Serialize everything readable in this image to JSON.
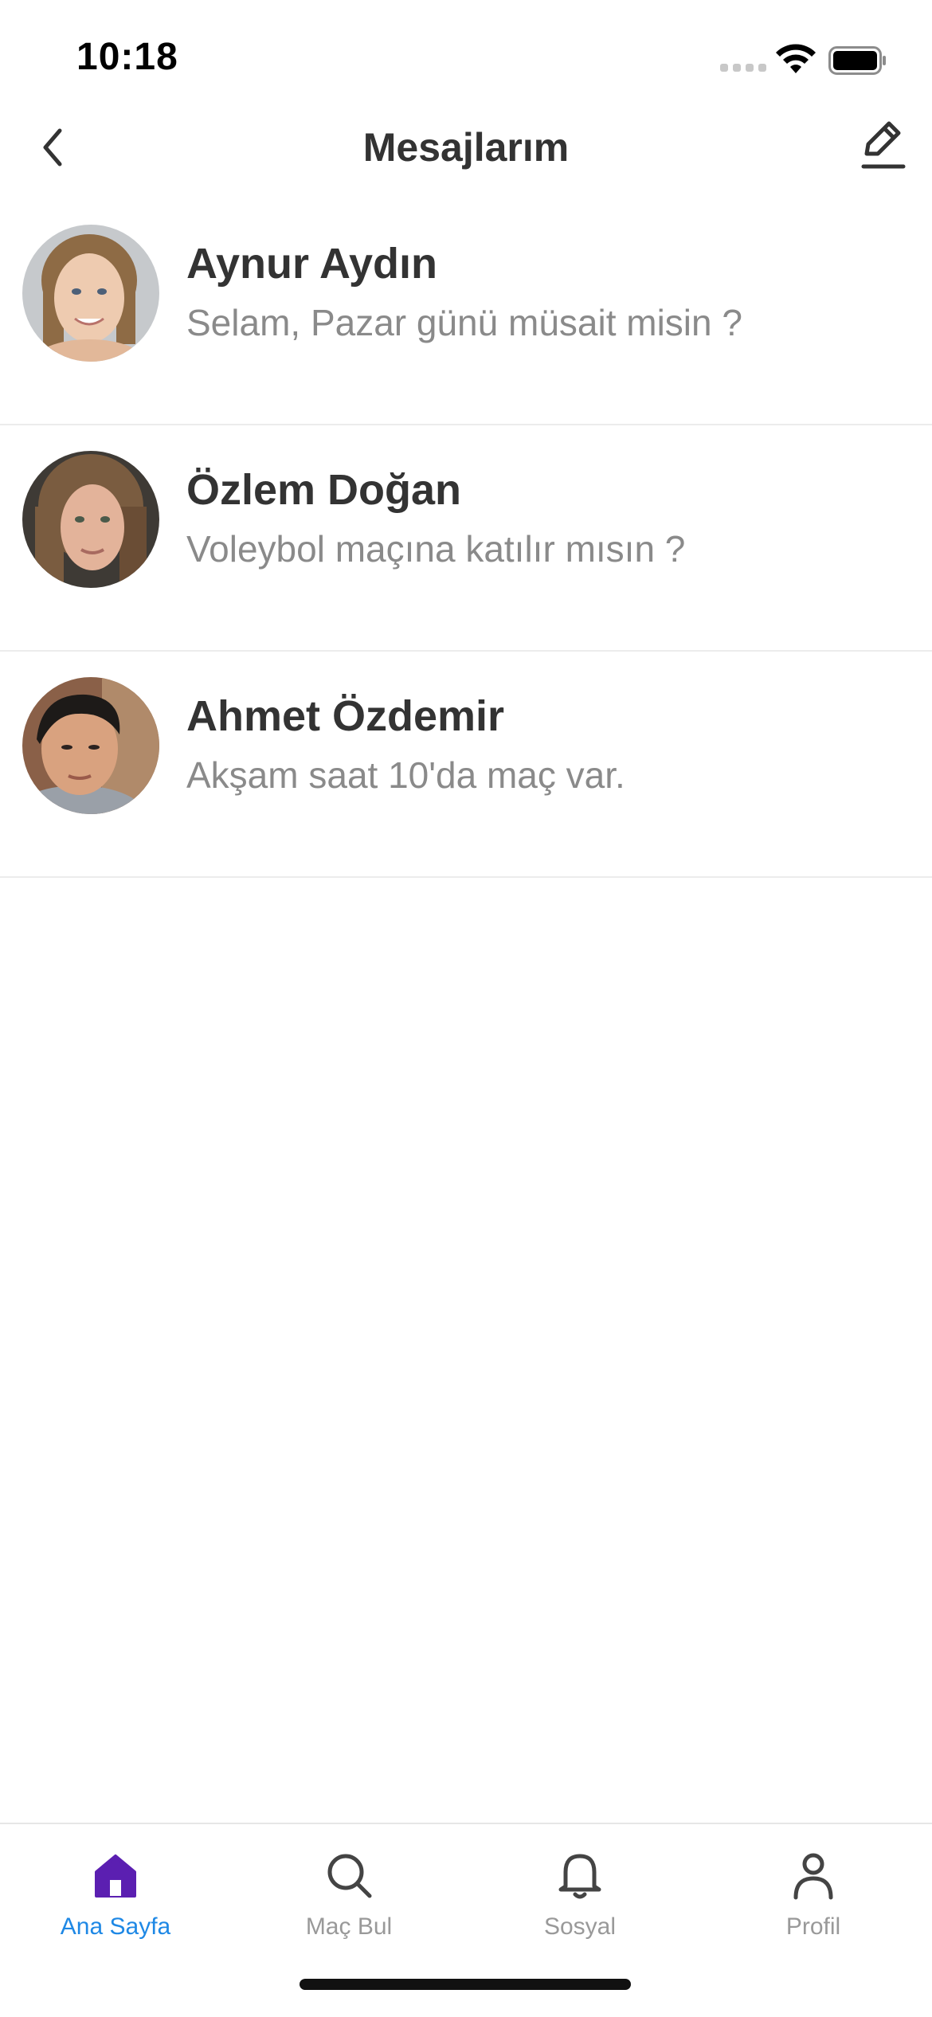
{
  "status_bar": {
    "time": "10:18"
  },
  "header": {
    "title": "Mesajlarım"
  },
  "conversations": [
    {
      "name": "Aynur Aydın",
      "preview": "Selam, Pazar günü müsait misin ?"
    },
    {
      "name": "Özlem Doğan",
      "preview": "Voleybol maçına katılır mısın ?"
    },
    {
      "name": "Ahmet Özdemir",
      "preview": "Akşam saat 10'da maç var."
    }
  ],
  "tabbar": {
    "active_color": "#1e88e5",
    "home_icon_color": "#5b1fb1",
    "items": [
      {
        "label": "Ana Sayfa",
        "icon": "home-icon",
        "active": true
      },
      {
        "label": "Maç Bul",
        "icon": "search-icon",
        "active": false
      },
      {
        "label": "Sosyal",
        "icon": "bell-icon",
        "active": false
      },
      {
        "label": "Profil",
        "icon": "person-icon",
        "active": false
      }
    ]
  }
}
